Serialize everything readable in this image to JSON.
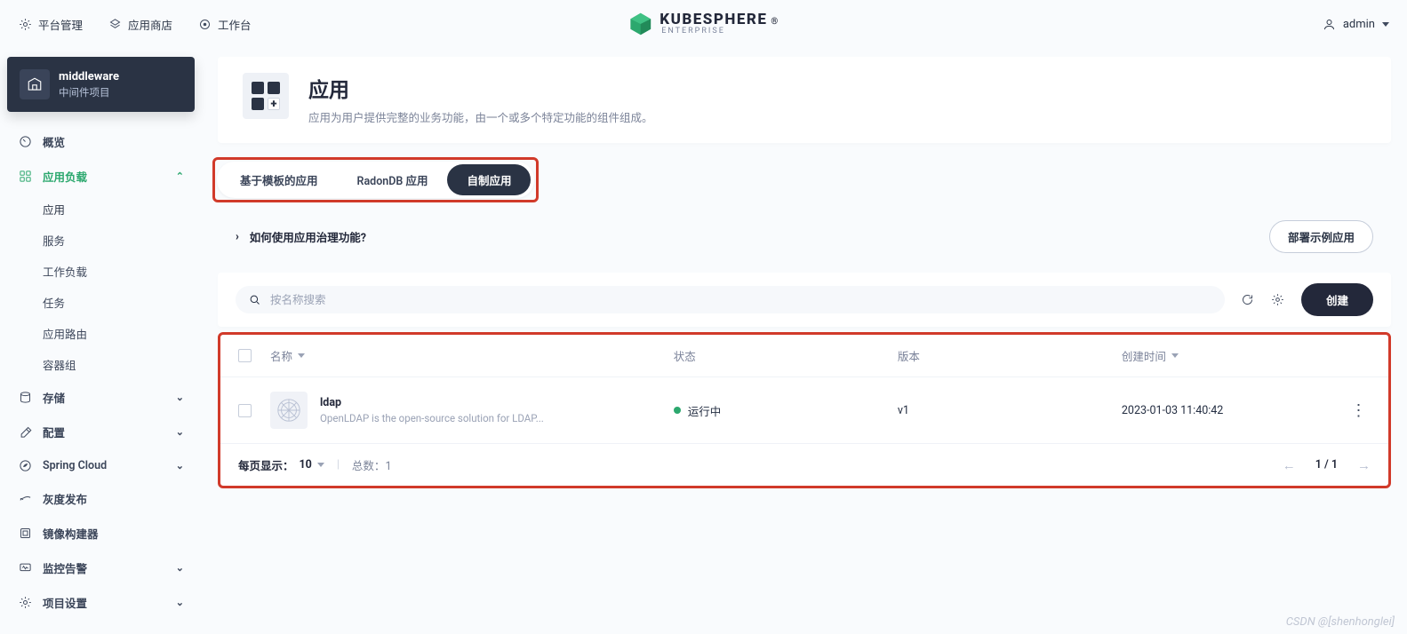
{
  "topnav": {
    "platform": "平台管理",
    "appstore": "应用商店",
    "workbench": "工作台"
  },
  "logo": {
    "name": "KUBESPHERE",
    "reg": "®",
    "sub": "ENTERPRISE"
  },
  "user": {
    "name": "admin"
  },
  "project": {
    "name": "middleware",
    "sub": "中间件项目"
  },
  "sidebar": {
    "overview": "概览",
    "workloads": {
      "label": "应用负载",
      "items": [
        "应用",
        "服务",
        "工作负载",
        "任务",
        "应用路由",
        "容器组"
      ]
    },
    "storage": "存储",
    "config": "配置",
    "spring": "Spring Cloud",
    "gray": "灰度发布",
    "image": "镜像构建器",
    "monitor": "监控告警",
    "settings": "项目设置"
  },
  "page": {
    "title": "应用",
    "desc": "应用为用户提供完整的业务功能，由一个或多个特定功能的组件组成。"
  },
  "tabs": {
    "template": "基于模板的应用",
    "radondb": "RadonDB 应用",
    "custom": "自制应用"
  },
  "help_link": "如何使用应用治理功能?",
  "deploy_sample": "部署示例应用",
  "search": {
    "placeholder": "按名称搜索"
  },
  "create_btn": "创建",
  "table": {
    "headers": {
      "name": "名称",
      "status": "状态",
      "version": "版本",
      "time": "创建时间"
    },
    "rows": [
      {
        "name": "ldap",
        "desc": "OpenLDAP is the open-source solution for LDAP...",
        "status": "运行中",
        "version": "v1",
        "time": "2023-01-03 11:40:42"
      }
    ],
    "per_page_label": "每页显示：",
    "per_page": "10",
    "total_label": "总数：",
    "total": "1",
    "page": "1 / 1"
  },
  "watermark": "CSDN @[shenhonglei]"
}
